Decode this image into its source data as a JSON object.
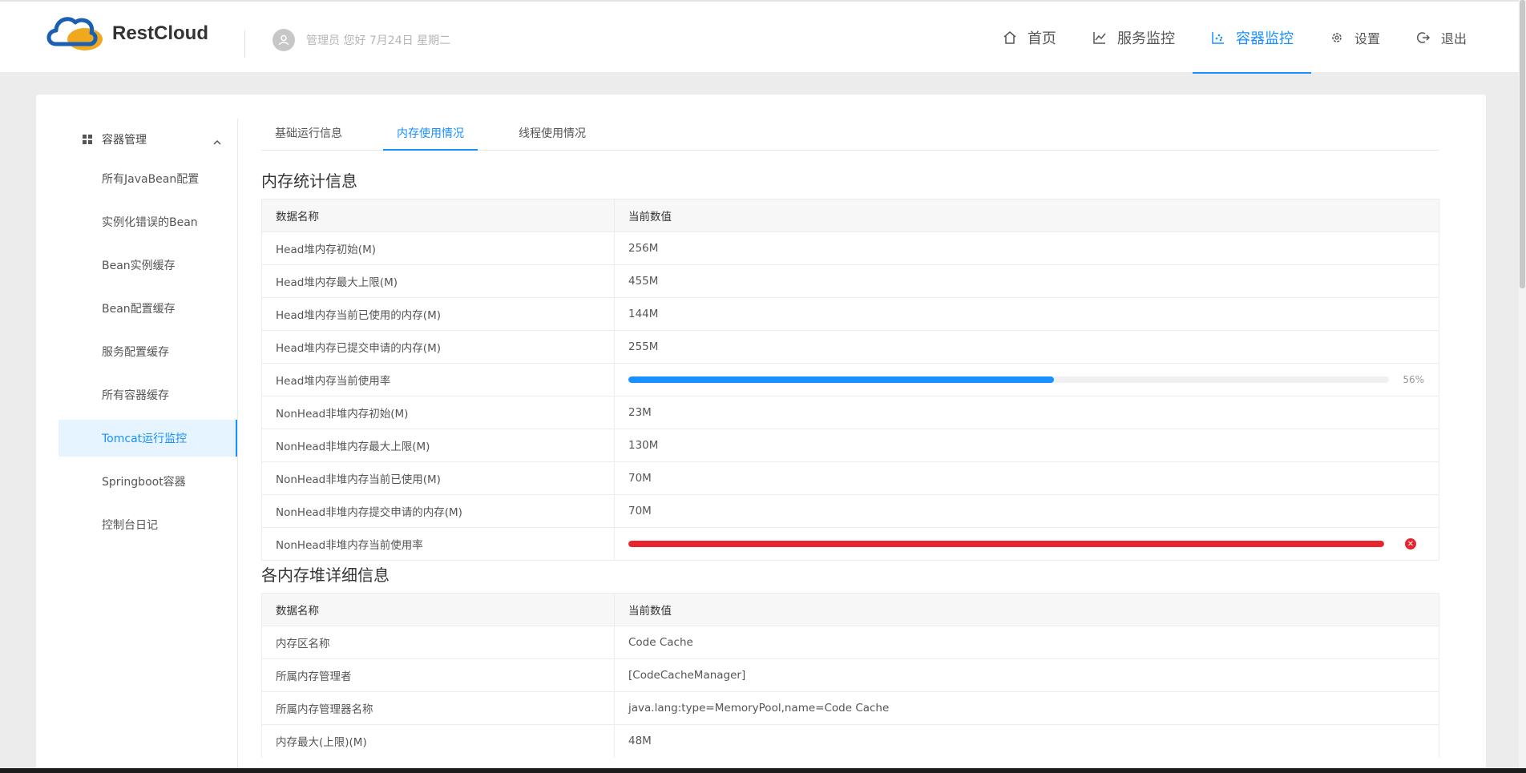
{
  "header": {
    "brand": "RestCloud",
    "user_text": "管理员 您好 7月24日 星期二",
    "nav": [
      {
        "label": "首页",
        "icon": "home-icon"
      },
      {
        "label": "服务监控",
        "icon": "line-chart-icon"
      },
      {
        "label": "容器监控",
        "icon": "dot-chart-icon",
        "active": true
      },
      {
        "label": "设置",
        "icon": "gear-icon"
      },
      {
        "label": "退出",
        "icon": "logout-icon"
      }
    ]
  },
  "sidebar": {
    "group": "容器管理",
    "items": [
      {
        "label": "所有JavaBean配置"
      },
      {
        "label": "实例化错误的Bean"
      },
      {
        "label": "Bean实例缓存"
      },
      {
        "label": "Bean配置缓存"
      },
      {
        "label": "服务配置缓存"
      },
      {
        "label": "所有容器缓存"
      },
      {
        "label": "Tomcat运行监控",
        "active": true
      },
      {
        "label": "Springboot容器"
      },
      {
        "label": "控制台日记"
      }
    ]
  },
  "tabs": [
    {
      "label": "基础运行信息"
    },
    {
      "label": "内存使用情况",
      "active": true
    },
    {
      "label": "线程使用情况"
    }
  ],
  "memory_stats": {
    "title": "内存统计信息",
    "columns": [
      "数据名称",
      "当前数值"
    ],
    "rows": [
      {
        "name": "Head堆内存初始(M)",
        "value": "256M"
      },
      {
        "name": "Head堆内存最大上限(M)",
        "value": "455M"
      },
      {
        "name": "Head堆内存当前已使用的内存(M)",
        "value": "144M"
      },
      {
        "name": "Head堆内存已提交申请的内存(M)",
        "value": "255M"
      },
      {
        "name": "Head堆内存当前使用率",
        "progress": 0.56,
        "progress_label": "56%",
        "status": "normal"
      },
      {
        "name": "NonHead非堆内存初始(M)",
        "value": "23M"
      },
      {
        "name": "NonHead非堆内存最大上限(M)",
        "value": "130M"
      },
      {
        "name": "NonHead非堆内存当前已使用(M)",
        "value": "70M"
      },
      {
        "name": "NonHead非堆内存提交申请的内存(M)",
        "value": "70M"
      },
      {
        "name": "NonHead非堆内存当前使用率",
        "progress": 1.0,
        "status": "exception"
      }
    ]
  },
  "heap_detail": {
    "title": "各内存堆详细信息",
    "columns": [
      "数据名称",
      "当前数值"
    ],
    "rows": [
      {
        "name": "内存区名称",
        "value": "Code Cache"
      },
      {
        "name": "所属内存管理者",
        "value": "[CodeCacheManager]"
      },
      {
        "name": "所属内存管理器名称",
        "value": "java.lang:type=MemoryPool,name=Code Cache"
      },
      {
        "name": "内存最大(上限)(M)",
        "value": "48M"
      }
    ]
  },
  "colors": {
    "accent": "#1890ff",
    "error": "#e8242f",
    "logo_blue": "#1a5fb4",
    "logo_orange": "#f0a81e"
  }
}
